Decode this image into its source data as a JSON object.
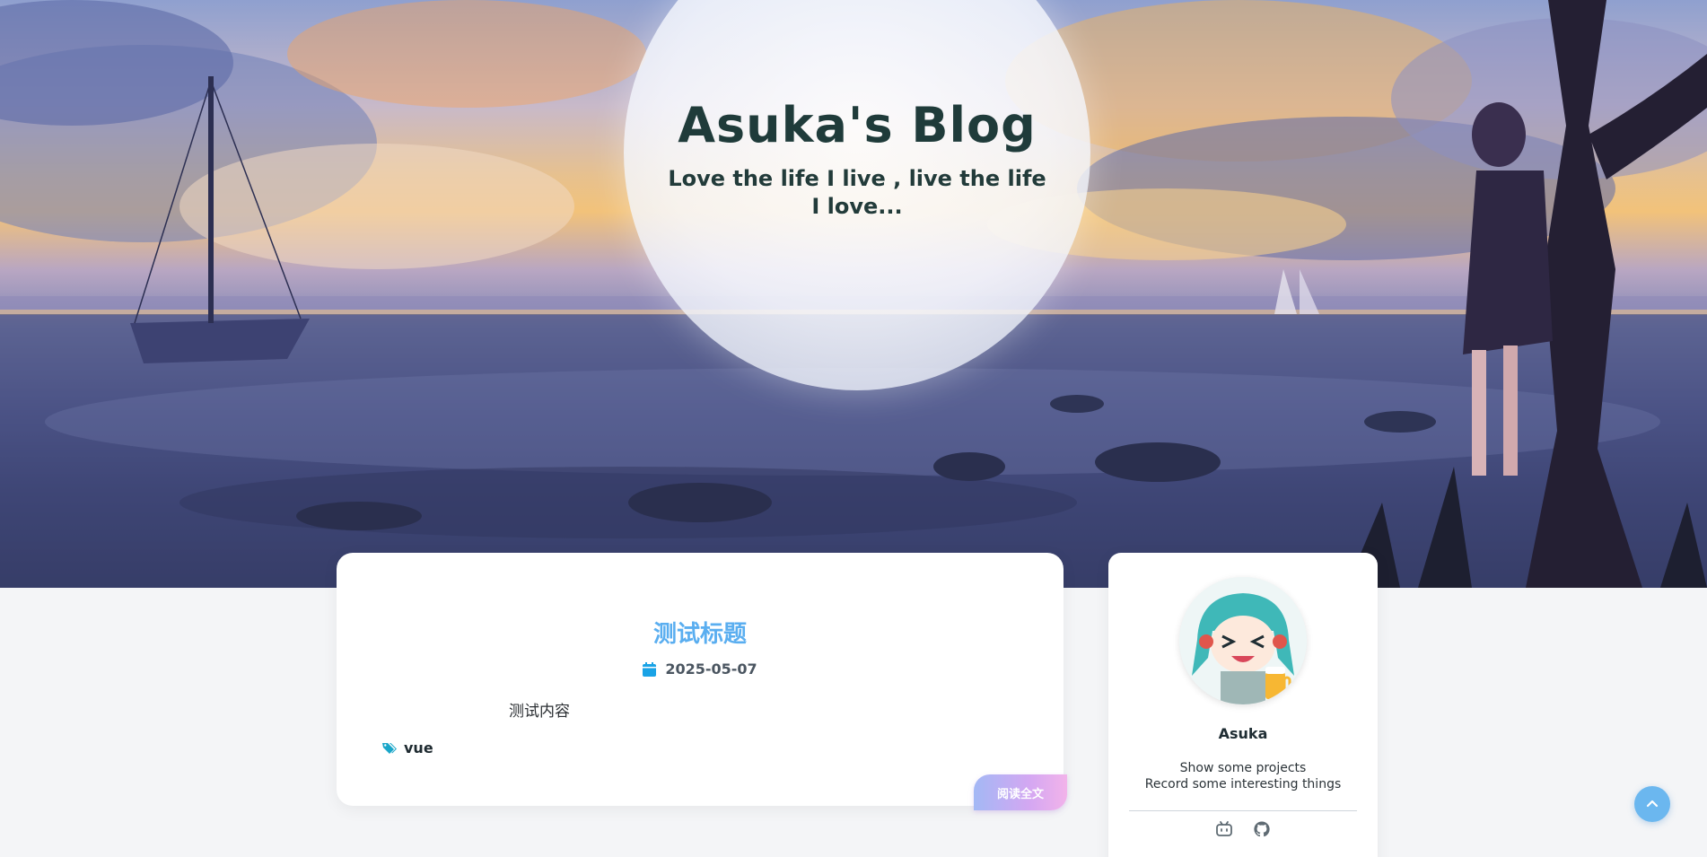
{
  "header": {
    "title": "Asuka's Blog",
    "subtitle": "Love the life I live , live the life I love..."
  },
  "post": {
    "title": "测试标题",
    "date": "2025-05-07",
    "content": "测试内容",
    "tags": [
      "vue"
    ],
    "read_more_label": "阅读全文"
  },
  "profile": {
    "name": "Asuka",
    "bio_line1": "Show some projects",
    "bio_line2": "Record some interesting things",
    "links": [
      {
        "icon": "bilibili-icon"
      },
      {
        "icon": "github-icon"
      }
    ]
  },
  "colors": {
    "accent": "#5aaef0",
    "title_text": "#1f3b3a",
    "calendar": "#1aa3e6",
    "tag_icon": "#1aa6c9",
    "back_to_top": "#6bb7ef"
  },
  "icons": {
    "back_to_top": "chevron-up-icon",
    "date": "calendar-icon",
    "tags": "tags-icon"
  }
}
